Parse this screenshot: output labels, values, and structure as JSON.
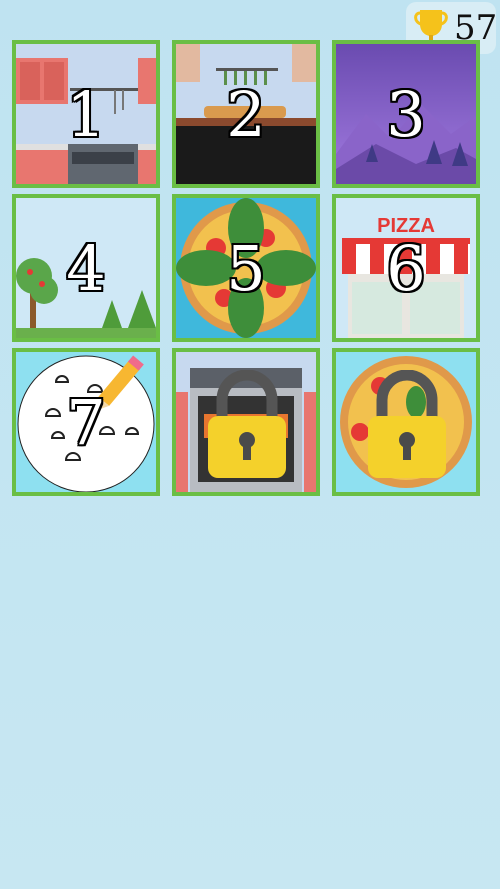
{
  "score": {
    "value": "57",
    "icon": "trophy-icon"
  },
  "levels": [
    {
      "number": "1",
      "theme": "kitchen",
      "locked": false
    },
    {
      "number": "2",
      "theme": "kitchen-counter",
      "locked": false
    },
    {
      "number": "3",
      "theme": "night-mountains",
      "locked": false
    },
    {
      "number": "4",
      "theme": "garden",
      "locked": false
    },
    {
      "number": "5",
      "theme": "basil-pizza",
      "locked": false
    },
    {
      "number": "6",
      "theme": "pizza-shop",
      "locked": false
    },
    {
      "number": "7",
      "theme": "drawing-mushrooms",
      "locked": false
    },
    {
      "number": "",
      "theme": "oven",
      "locked": true
    },
    {
      "number": "",
      "theme": "pepperoni-pizza",
      "locked": true
    }
  ],
  "shop_sign": "PIZZA",
  "colors": {
    "tile_border": "#6abe45",
    "lock": "#f4d12b",
    "background": "#c4e6f2"
  }
}
